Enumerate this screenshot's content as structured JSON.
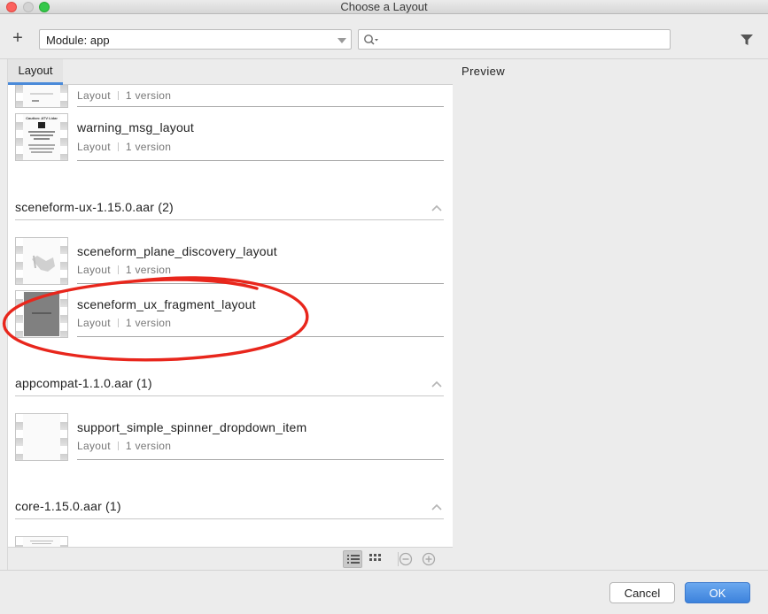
{
  "window": {
    "title": "Choose a Layout"
  },
  "toolbar": {
    "add_label": "+",
    "module_select": "Module: app",
    "search_value": "",
    "search_placeholder": ""
  },
  "tabs": {
    "layout": "Layout"
  },
  "preview": {
    "label": "Preview"
  },
  "list": {
    "top_items": [
      {
        "name": "",
        "type": "Layout",
        "versions": "1 version"
      },
      {
        "name": "warning_msg_layout",
        "type": "Layout",
        "versions": "1 version"
      }
    ],
    "groups": [
      {
        "title": "sceneform-ux-1.15.0.aar (2)",
        "items": [
          {
            "name": "sceneform_plane_discovery_layout",
            "type": "Layout",
            "versions": "1 version"
          },
          {
            "name": "sceneform_ux_fragment_layout",
            "type": "Layout",
            "versions": "1 version"
          }
        ]
      },
      {
        "title": "appcompat-1.1.0.aar (1)",
        "items": [
          {
            "name": "support_simple_spinner_dropdown_item",
            "type": "Layout",
            "versions": "1 version"
          }
        ]
      },
      {
        "title": "core-1.15.0.aar (1)",
        "items": []
      }
    ]
  },
  "thumbs": {
    "warning_caption": "Caution: ATV Lidar"
  },
  "footer": {
    "cancel_label": "Cancel",
    "ok_label": "OK"
  },
  "icons": {
    "add": "plus-icon",
    "search": "search-icon",
    "filter": "filter-icon",
    "collapse": "chevron-up-icon",
    "list_view": "list-view-icon",
    "grid_view": "grid-view-icon",
    "zoom_out": "zoom-out-icon",
    "zoom_in": "zoom-in-icon"
  },
  "colors": {
    "accent": "#4a8ad9",
    "ok_button": "#3c82dc",
    "annotation_circle": "#e8261c"
  }
}
